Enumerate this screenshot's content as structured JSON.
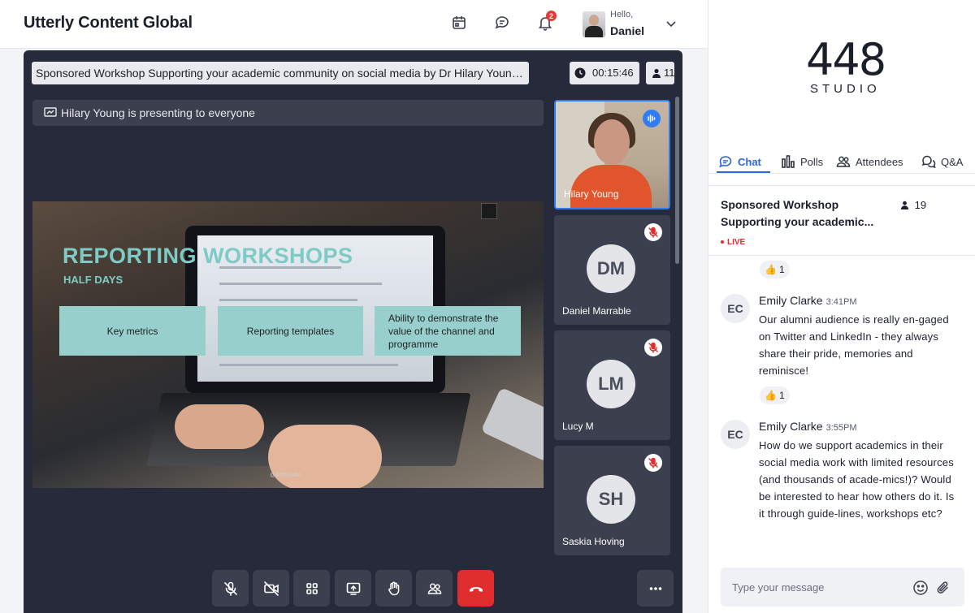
{
  "header": {
    "brand": "Utterly Content Global",
    "notification_count": "2",
    "greeting": "Hello,",
    "user_name": "Daniel"
  },
  "session": {
    "title": "Sponsored Workshop Supporting your academic community on social media by Dr Hilary Young, H...",
    "timer": "00:15:46",
    "participants": "11",
    "presenting_banner": "Hilary Young is presenting to everyone"
  },
  "slide": {
    "title": "REPORTING WORKSHOPS",
    "subtitle": "HALF DAYS",
    "boxes": [
      "Key metrics",
      "Reporting templates",
      "Ability to demonstrate the value of the channel and programme"
    ],
    "handle": "@448Studio"
  },
  "tiles": [
    {
      "name": "Hilary Young",
      "initials": "",
      "speaking": true
    },
    {
      "name": "Daniel Marrable",
      "initials": "DM",
      "muted": true
    },
    {
      "name": "Lucy M",
      "initials": "LM",
      "muted": true
    },
    {
      "name": "Saskia Hoving",
      "initials": "SH",
      "muted": true
    }
  ],
  "controls": [
    "mic-off",
    "camera-off",
    "grid-view",
    "share-screen",
    "raise-hand",
    "participants",
    "end-call",
    "more"
  ],
  "sidebar": {
    "logo_number": "448",
    "logo_word": "STUDIO",
    "tabs": [
      {
        "label": "Chat",
        "icon": "chat-icon",
        "active": true
      },
      {
        "label": "Polls",
        "icon": "bar-chart-icon"
      },
      {
        "label": "Attendees",
        "icon": "people-icon"
      },
      {
        "label": "Q&A",
        "icon": "qa-icon"
      }
    ],
    "chat_title_line1": "Sponsored Workshop",
    "chat_title_line2": "Supporting your academic...",
    "chat_count": "19",
    "live_label": "LIVE"
  },
  "messages": [
    {
      "initials": "EC",
      "author": "Emily Clarke",
      "time": "3:41PM",
      "text": "Our alumni audience is really en-gaged on Twitter and LinkedIn - they always share their pride, memories and reminisce!",
      "reaction": "1"
    },
    {
      "initials": "EC",
      "author": "Emily Clarke",
      "time": "3:55PM",
      "text": "How do we support academics in their social media work with limited resources (and thousands of acade-mics!)? Would be interested to hear how others do it. Is it through guide-lines, workshops etc?"
    }
  ],
  "top_reaction": "1",
  "composer": {
    "placeholder": "Type your message"
  },
  "colors": {
    "accent": "#2f66d4",
    "stage_bg": "#262a3b",
    "tile_bg": "#3b3f4e",
    "end_call": "#e02d2d",
    "slide_teal": "#96cfcb"
  }
}
